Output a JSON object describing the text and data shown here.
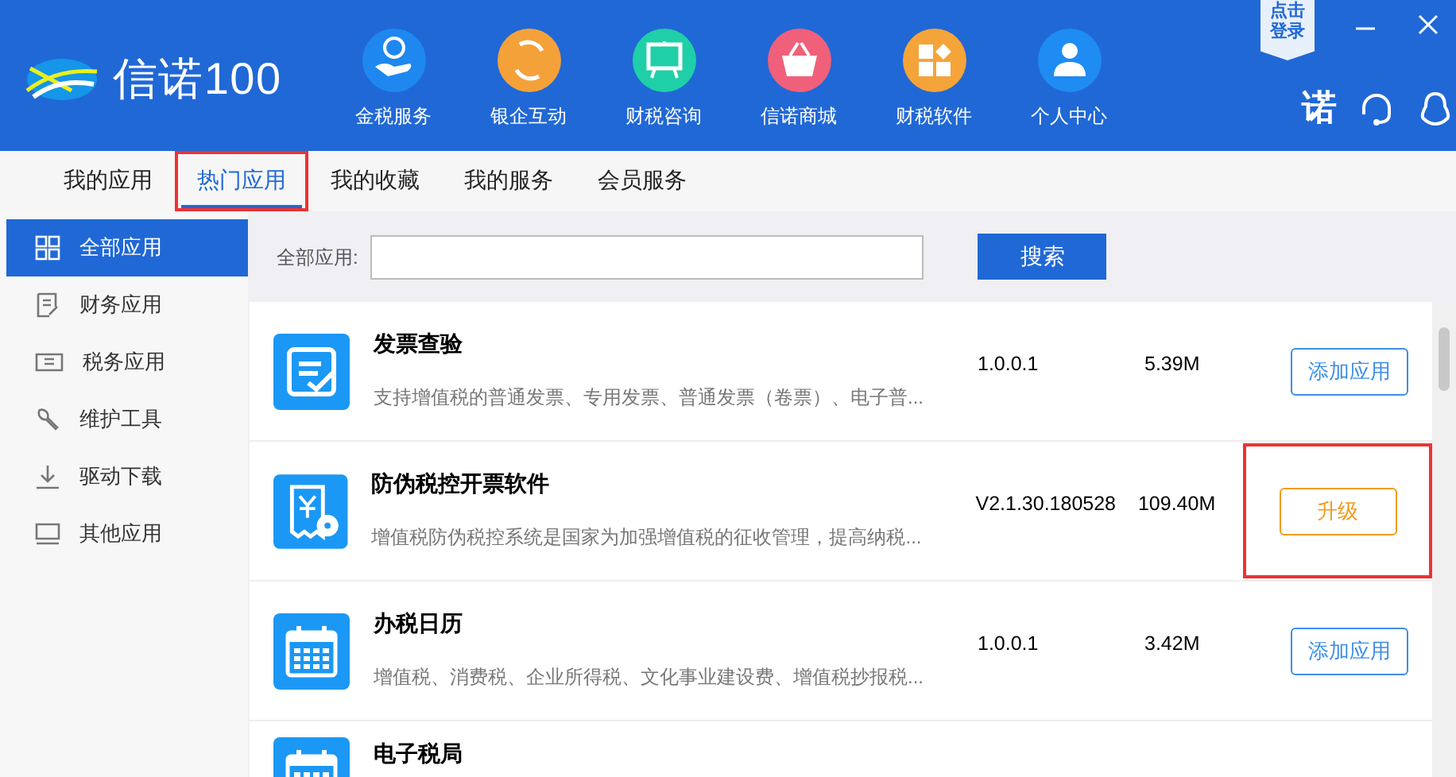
{
  "header": {
    "logo": "信诺100",
    "login_badge": "点击登录",
    "nav": [
      {
        "label": "金税服务",
        "kind": "tax",
        "color": "#1e88f0"
      },
      {
        "label": "银企互动",
        "kind": "bank",
        "color": "#f5a13a"
      },
      {
        "label": "财税咨询",
        "kind": "board",
        "color": "#1fcfa8"
      },
      {
        "label": "信诺商城",
        "kind": "basket",
        "color": "#f0607a"
      },
      {
        "label": "财税软件",
        "kind": "blocks",
        "color": "#f5a43a"
      },
      {
        "label": "个人中心",
        "kind": "person",
        "color": "#1e8cf2"
      }
    ],
    "brand_char": "诺"
  },
  "tabs": [
    {
      "label": "我的应用",
      "selected": false,
      "highlighted": false
    },
    {
      "label": "热门应用",
      "selected": true,
      "highlighted": true
    },
    {
      "label": "我的收藏",
      "selected": false,
      "highlighted": false
    },
    {
      "label": "我的服务",
      "selected": false,
      "highlighted": false
    },
    {
      "label": "会员服务",
      "selected": false,
      "highlighted": false
    }
  ],
  "sidebar": {
    "items": [
      {
        "label": "全部应用",
        "kind": "grid",
        "selected": true
      },
      {
        "label": "财务应用",
        "kind": "note",
        "selected": false
      },
      {
        "label": "税务应用",
        "kind": "ticket",
        "selected": false
      },
      {
        "label": "维护工具",
        "kind": "wrench",
        "selected": false
      },
      {
        "label": "驱动下载",
        "kind": "download",
        "selected": false
      },
      {
        "label": "其他应用",
        "kind": "monitor",
        "selected": false
      }
    ]
  },
  "search": {
    "label": "全部应用:",
    "button": "搜索"
  },
  "apps": [
    {
      "name": "发票查验",
      "kind": "invoice",
      "description": "支持增值税的普通发票、专用发票、普通发票（卷票）、电子普...",
      "version": "1.0.0.1",
      "size": "5.39M",
      "button": {
        "label": "添加应用",
        "kind": "add"
      },
      "highlighted": false
    },
    {
      "name": "防伪税控开票软件",
      "kind": "receipt",
      "description": "增值税防伪税控系统是国家为加强增值税的征收管理，提高纳税...",
      "version": "V2.1.30.180528",
      "size": "109.40M",
      "button": {
        "label": "升级",
        "kind": "upgrade"
      },
      "highlighted": true
    },
    {
      "name": "办税日历",
      "kind": "calendar",
      "description": "增值税、消费税、企业所得税、文化事业建设费、增值税抄报税...",
      "version": "1.0.0.1",
      "size": "3.42M",
      "button": {
        "label": "添加应用",
        "kind": "add"
      },
      "highlighted": false
    },
    {
      "name": "电子税局",
      "kind": "calendar"
    }
  ]
}
